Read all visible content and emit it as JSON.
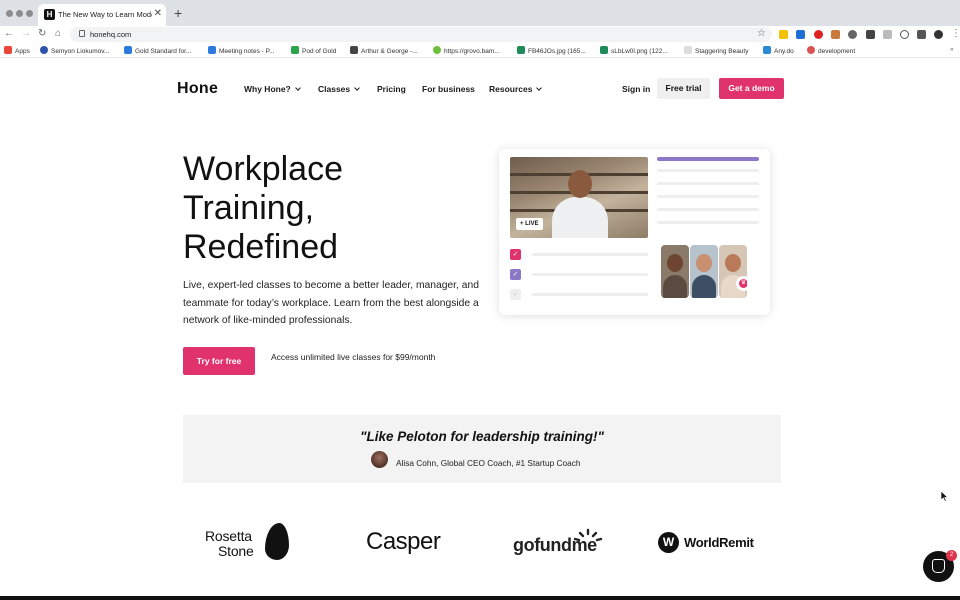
{
  "browser": {
    "tab_title": "The New Way to Learn Modern",
    "tab_favicon": "H",
    "url": "honehq.com",
    "bookmarks": [
      "Apps",
      "Semyon Liokumov...",
      "Gold Standard for...",
      "Meeting notes - P...",
      "Pod of Gold",
      "Arthur & George -...",
      "https://grovo.bam...",
      "FB46JOs.jpg (165...",
      "sLbLw0l.png (122...",
      "Staggering Beauty",
      "Any.do",
      "development"
    ]
  },
  "header": {
    "logo": "Hone",
    "nav": [
      "Why Hone?",
      "Classes",
      "Pricing",
      "For business",
      "Resources"
    ],
    "sign_in": "Sign in",
    "free_trial": "Free trial",
    "get_demo": "Get a demo"
  },
  "hero": {
    "title_line1": "Workplace",
    "title_line2": "Training,",
    "title_line3": "Redefined",
    "subtitle": "Live, expert-led classes to become a better leader, manager, and teammate for today’s workplace. Learn from the best alongside a network of like-minded professionals.",
    "cta": "Try for free",
    "cta_note": "Access unlimited live classes for $99/month",
    "live_badge": "LIVE"
  },
  "quote": {
    "text": "\"Like Peloton for leadership training!\"",
    "attribution": "Alisa Cohn, Global CEO Coach, #1 Startup Coach"
  },
  "logos": {
    "rosetta_line1": "Rosetta",
    "rosetta_line2": "Stone",
    "casper": "Casper",
    "gofundme": "gofundme",
    "worldremit": "WorldRemit"
  },
  "chat": {
    "badge_count": "2"
  },
  "colors": {
    "brand_pink": "#e0336d",
    "accent_purple": "#8b78c9"
  }
}
